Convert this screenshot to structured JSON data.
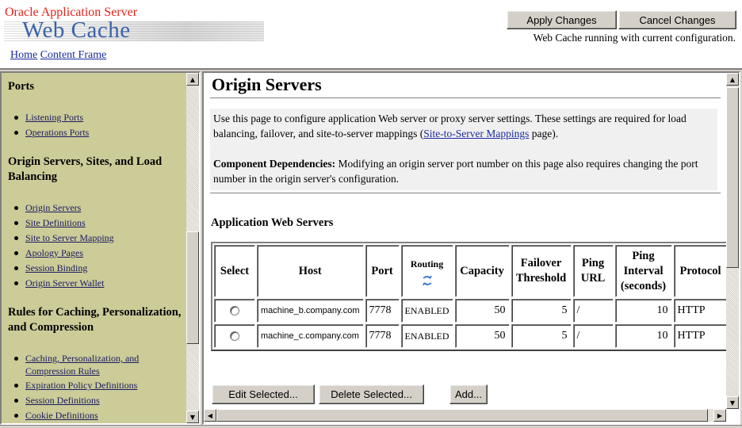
{
  "header": {
    "product_name": "Oracle Application Server",
    "product_subtitle": "Web Cache",
    "links": [
      "Home",
      "Content Frame"
    ],
    "apply_label": "Apply Changes",
    "cancel_label": "Cancel Changes",
    "status": "Web Cache running with current configuration."
  },
  "nav": {
    "sections": [
      {
        "title": "Ports",
        "items": [
          "Listening Ports",
          "Operations Ports"
        ]
      },
      {
        "title": "Origin Servers, Sites, and Load Balancing",
        "items": [
          "Origin Servers",
          "Site Definitions",
          "Site to Server Mapping",
          "Apology Pages",
          "Session Binding",
          "Origin Server Wallet"
        ]
      },
      {
        "title": "Rules for Caching, Personalization, and Compression",
        "items": [
          "Caching, Personalization, and Compression Rules",
          "Expiration Policy Definitions",
          "Session Definitions",
          "Cookie Definitions"
        ]
      }
    ]
  },
  "main": {
    "title": "Origin Servers",
    "description_before_link": "Use this page to configure application Web server or proxy server settings. These settings are required for load balancing, failover, and site-to-server mappings (",
    "description_link": "Site-to-Server Mappings",
    "description_after_link": " page).",
    "dependencies_label": "Component Dependencies:",
    "dependencies_text": " Modifying an origin server port number on this page also requires changing the port number in the origin server's configuration.",
    "table_title": "Application Web Servers",
    "columns": {
      "select": "Select",
      "host": "Host",
      "port": "Port",
      "routing": "Routing",
      "capacity": "Capacity",
      "failover": "Failover Threshold",
      "ping_url": "Ping URL",
      "ping_interval": "Ping Interval (seconds)",
      "protocol": "Protocol"
    },
    "rows": [
      {
        "host": "machine_b.company.com",
        "port": "7778",
        "routing": "ENABLED",
        "capacity": "50",
        "failover": "5",
        "ping_url": "/",
        "ping_interval": "10",
        "protocol": "HTTP"
      },
      {
        "host": "machine_c.company.com",
        "port": "7778",
        "routing": "ENABLED",
        "capacity": "50",
        "failover": "5",
        "ping_url": "/",
        "ping_interval": "10",
        "protocol": "HTTP"
      }
    ],
    "edit_label": "Edit Selected...",
    "delete_label": "Delete Selected...",
    "add_label": "Add..."
  }
}
